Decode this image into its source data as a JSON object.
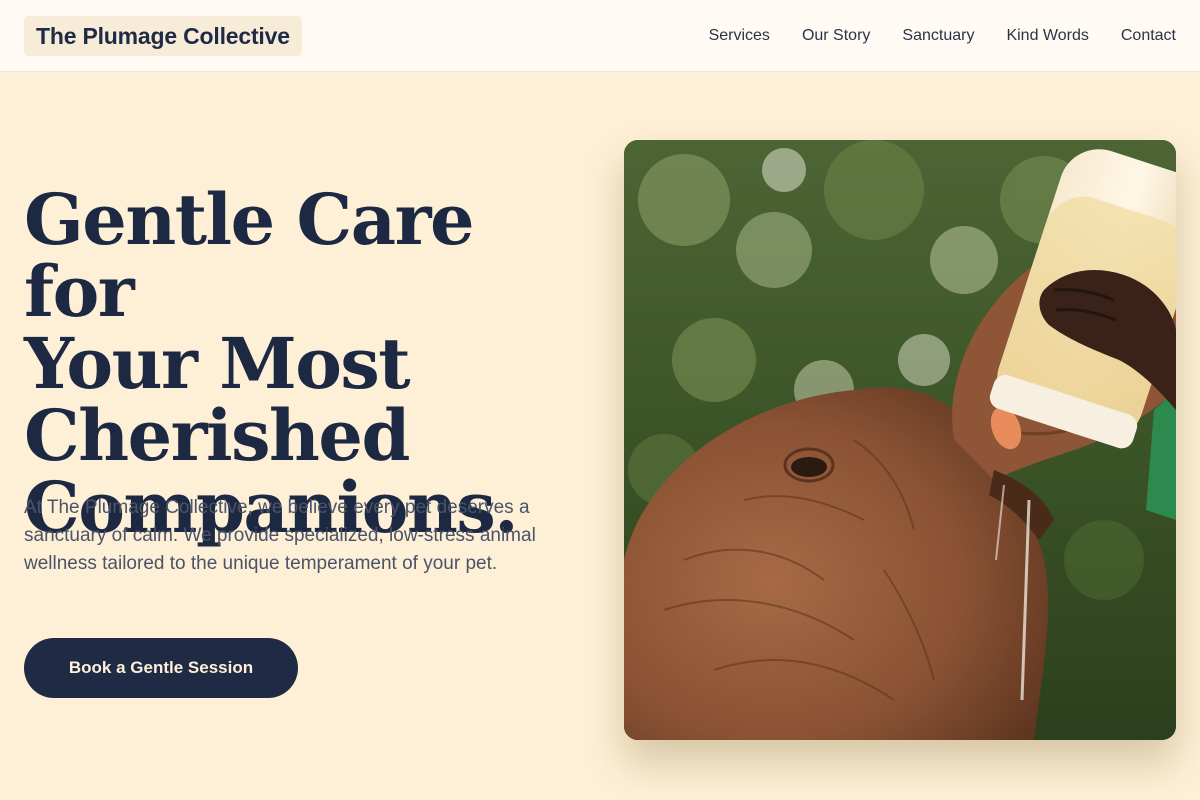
{
  "header": {
    "brand": "The Plumage Collective",
    "nav": [
      "Services",
      "Our Story",
      "Sanctuary",
      "Kind Words",
      "Contact"
    ]
  },
  "hero": {
    "headline": [
      "Gentle Care for",
      "Your Most",
      "Cherished",
      "Companions."
    ],
    "lead": "At The Plumage Collective, we believe every pet deserves a sanctuary of calm. We provide specialized, low-stress animal wellness tailored to the unique temperament of your pet.",
    "cta_label": "Book a Gentle Session"
  },
  "photo": {
    "subject": "baby elephant bottle-feeding photo"
  },
  "colors": {
    "background": "#fdf0d6",
    "header_bg": "#fffaf3",
    "brand_chip": "#f7ecd8",
    "navy": "#1f2a44",
    "body_text": "#4a5468"
  }
}
